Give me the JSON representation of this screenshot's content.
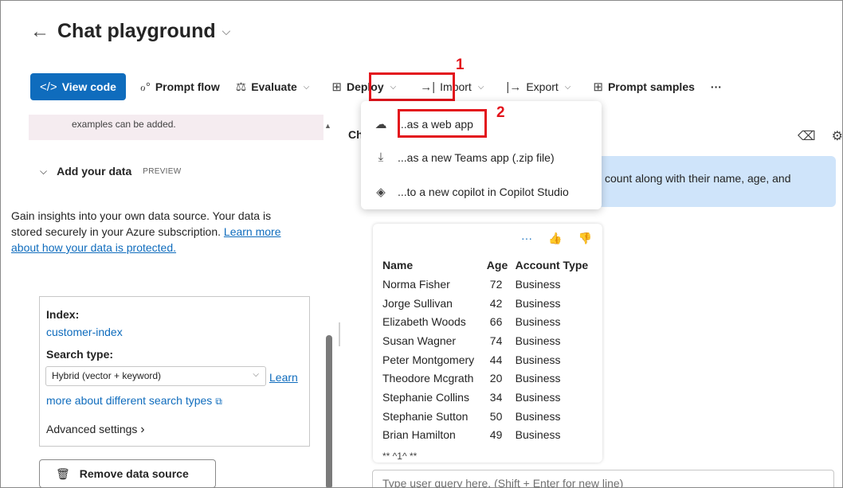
{
  "header": {
    "back_icon": "back-arrow-icon",
    "title": "Chat playground"
  },
  "toolbar": {
    "view_code": "View code",
    "prompt_flow": "Prompt flow",
    "evaluate": "Evaluate",
    "deploy": "Deploy",
    "import": "Import",
    "export": "Export",
    "prompt_samples": "Prompt samples",
    "more": "···"
  },
  "annotations": {
    "step1": "1",
    "step2": "2",
    "color": "#e3141c"
  },
  "deploy_menu": {
    "items": [
      {
        "label": "...as a web app",
        "icon": "cloud-icon"
      },
      {
        "label": "...as a new Teams app (.zip file)",
        "icon": "download-icon"
      },
      {
        "label": "...to a new copilot in Copilot Studio",
        "icon": "copilot-icon"
      }
    ]
  },
  "left": {
    "examples_note": "examples can be added.",
    "add_data_title": "Add your data",
    "preview_tag": "PREVIEW",
    "desc_text": "Gain insights into your own data source. Your data is stored securely in your Azure subscription. ",
    "desc_link": "Learn more about how your data is protected.",
    "index_label": "Index:",
    "index_value": "customer-index",
    "search_type_label": "Search type:",
    "search_type_value": "Hybrid (vector + keyword)",
    "learn_link_1": "Learn",
    "learn_link_2": "more about different search types",
    "advanced": "Advanced settings",
    "remove": "Remove data source"
  },
  "chat": {
    "title_fragment": "Ch",
    "user_message_fragment": "count  along with their name, age, and",
    "table": {
      "headers": [
        "Name",
        "Age",
        "Account Type"
      ],
      "rows": [
        [
          "Norma Fisher",
          "72",
          "Business"
        ],
        [
          "Jorge Sullivan",
          "42",
          "Business"
        ],
        [
          "Elizabeth Woods",
          "66",
          "Business"
        ],
        [
          "Susan Wagner",
          "74",
          "Business"
        ],
        [
          "Peter Montgomery",
          "44",
          "Business"
        ],
        [
          "Theodore Mcgrath",
          "20",
          "Business"
        ],
        [
          "Stephanie Collins",
          "34",
          "Business"
        ],
        [
          "Stephanie Sutton",
          "50",
          "Business"
        ],
        [
          "Brian Hamilton",
          "49",
          "Business"
        ]
      ]
    },
    "truncated": "** ^1^ **",
    "input_placeholder": "Type user query here. (Shift + Enter for new line)"
  },
  "colors": {
    "accent": "#0f6cbd",
    "user_bubble": "#cfe4fa",
    "note_bg": "#f5ecf0"
  }
}
